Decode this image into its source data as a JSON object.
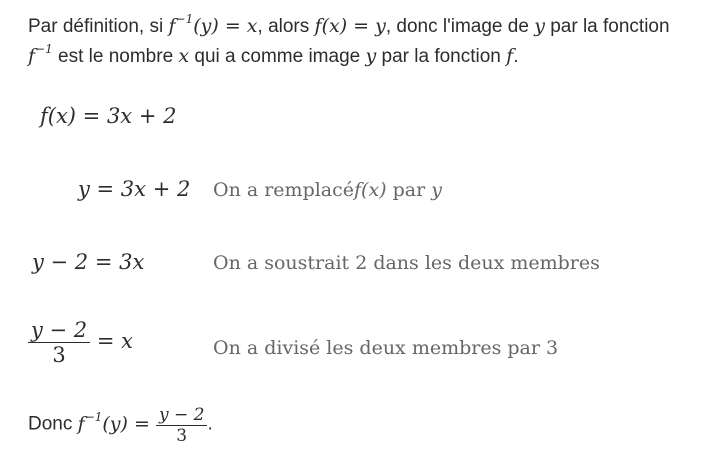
{
  "intro": {
    "t1": "Par définition, si ",
    "t2": ", alors ",
    "t3": ", donc l'image de ",
    "t4": " par la fonction",
    "t5": " est le nombre ",
    "t6": " qui a comme image ",
    "t7": " par la fonction ",
    "t8": "."
  },
  "math": {
    "finv_y": "f⁻¹(y) = x",
    "fx_eq_y": "f(x) = y",
    "y": "y",
    "finv": "f⁻¹",
    "x": "x",
    "f": "f"
  },
  "steps": [
    {
      "lhs": "f(x) = 3x + 2",
      "comment_pre": "",
      "comment_math": "",
      "comment_post": ""
    },
    {
      "lhs": "y = 3x + 2",
      "comment_pre": "On a remplacé",
      "comment_math": "f(x)",
      "comment_post": " par ",
      "comment_math2": "y"
    },
    {
      "lhs": "y − 2 = 3x",
      "comment": "On a soustrait 2 dans les deux membres"
    },
    {
      "num": "y − 2",
      "den": "3",
      "rhs": "= x",
      "comment": "On a divisé les deux membres par 3"
    }
  ],
  "conclusion": {
    "prefix": "Donc ",
    "lhs": "f⁻¹(y) = ",
    "num": "y − 2",
    "den": "3",
    "suffix": "."
  }
}
